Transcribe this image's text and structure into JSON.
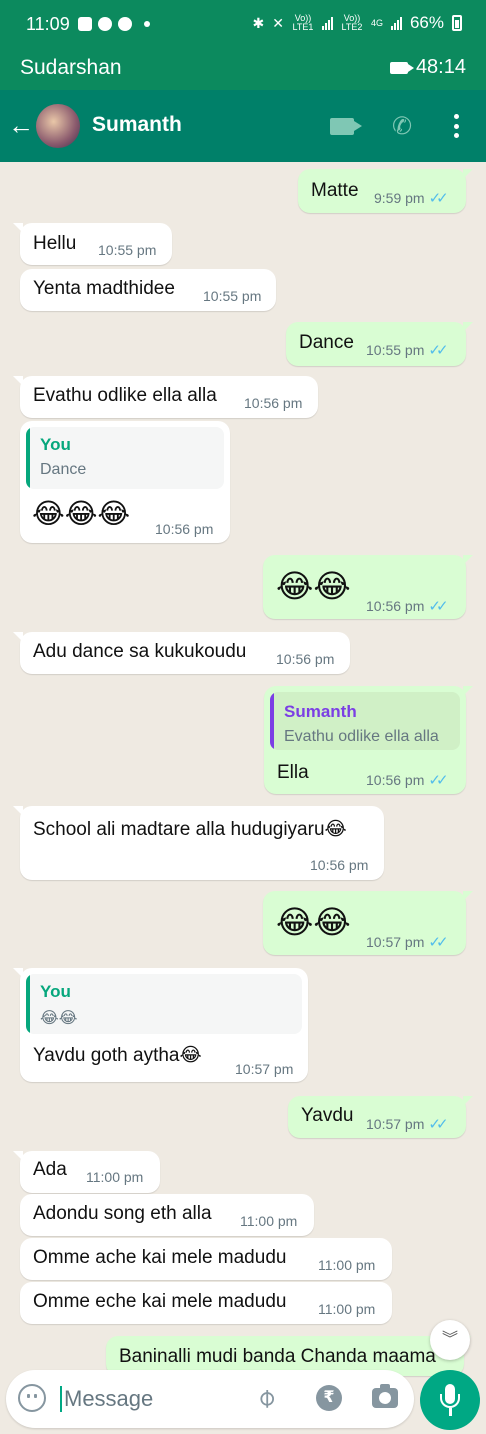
{
  "status_bar": {
    "time": "11:09",
    "lte1": "Vo)) LTE1",
    "lte2": "Vo)) LTE2",
    "net": "4G",
    "battery": "66%"
  },
  "call_bar": {
    "name": "Sudarshan",
    "timer": "48:14"
  },
  "header": {
    "contact_name": "Sumanth"
  },
  "messages": [
    {
      "dir": "out",
      "text": "Matte",
      "time": "9:59 pm",
      "ticks": "✓✓"
    },
    {
      "dir": "in",
      "text": "Hellu",
      "time": "10:55 pm"
    },
    {
      "dir": "in",
      "text": "Yenta madthidee",
      "time": "10:55 pm"
    },
    {
      "dir": "out",
      "text": "Dance",
      "time": "10:55 pm",
      "ticks": "✓✓"
    },
    {
      "dir": "in",
      "text": "Evathu odlike ella alla",
      "time": "10:56 pm"
    },
    {
      "dir": "in",
      "quote_author": "You",
      "quote_text": "Dance",
      "text": "😂😂😂",
      "time": "10:56 pm"
    },
    {
      "dir": "out",
      "text": "😂😂",
      "time": "10:56 pm",
      "ticks": "✓✓"
    },
    {
      "dir": "in",
      "text": "Adu dance sa kukukoudu",
      "time": "10:56 pm"
    },
    {
      "dir": "out",
      "quote_author": "Sumanth",
      "quote_text": "Evathu odlike ella alla",
      "text": "Ella",
      "time": "10:56 pm",
      "ticks": "✓✓"
    },
    {
      "dir": "in",
      "text": "School ali madtare alla hudugiyaru😂",
      "time": "10:56 pm"
    },
    {
      "dir": "out",
      "text": "😂😂",
      "time": "10:57 pm",
      "ticks": "✓✓"
    },
    {
      "dir": "in",
      "quote_author": "You",
      "quote_text": "😂😂",
      "text": "Yavdu goth aytha😂",
      "time": "10:57 pm"
    },
    {
      "dir": "out",
      "text": "Yavdu",
      "time": "10:57 pm",
      "ticks": "✓✓"
    },
    {
      "dir": "in",
      "text": "Ada",
      "time": "11:00 pm"
    },
    {
      "dir": "in",
      "text": "Adondu song eth alla",
      "time": "11:00 pm"
    },
    {
      "dir": "in",
      "text": "Omme ache kai mele madudu",
      "time": "11:00 pm"
    },
    {
      "dir": "in",
      "text": "Omme eche kai mele madudu",
      "time": "11:00 pm"
    },
    {
      "dir": "out",
      "text": "Baninalli mudi banda Chanda maama"
    }
  ],
  "input": {
    "placeholder": "Message",
    "rupee_symbol": "₹"
  },
  "colors": {
    "status_green": "#0c8a5e",
    "header_green": "#008069",
    "outgoing_bubble": "#d9fdd3",
    "incoming_bubble": "#ffffff",
    "chat_bg": "#efeae2",
    "tick_blue": "#53bdeb",
    "quote_you": "#06a77d",
    "quote_sumanth": "#7b3fe4",
    "mic_green": "#00a884"
  },
  "icons": [
    "back-arrow-icon",
    "video-call-icon",
    "voice-call-icon",
    "more-menu-icon",
    "emoji-icon",
    "attach-icon",
    "rupee-icon",
    "camera-icon",
    "mic-icon",
    "scroll-down-icon"
  ]
}
